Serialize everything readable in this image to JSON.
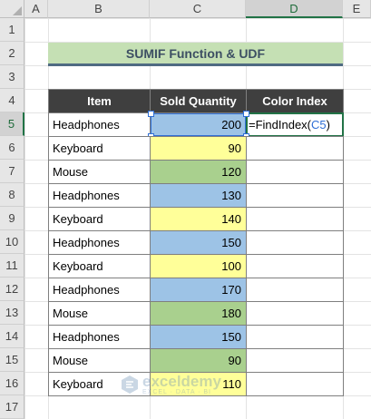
{
  "columns": [
    "A",
    "B",
    "C",
    "D",
    "E"
  ],
  "selected_column": "D",
  "rows": [
    "1",
    "2",
    "3",
    "4",
    "5",
    "6",
    "7",
    "8",
    "9",
    "10",
    "11",
    "12",
    "13",
    "14",
    "15",
    "16",
    "17"
  ],
  "selected_row": "5",
  "title": "SUMIF Function & UDF",
  "headers": {
    "item": "Item",
    "qty": "Sold Quantity",
    "color_index": "Color Index"
  },
  "table": [
    {
      "item": "Headphones",
      "qty": "200",
      "color": "blue"
    },
    {
      "item": "Keyboard",
      "qty": "90",
      "color": "yellow"
    },
    {
      "item": "Mouse",
      "qty": "120",
      "color": "green"
    },
    {
      "item": "Headphones",
      "qty": "130",
      "color": "blue"
    },
    {
      "item": "Keyboard",
      "qty": "140",
      "color": "yellow"
    },
    {
      "item": "Headphones",
      "qty": "150",
      "color": "blue"
    },
    {
      "item": "Keyboard",
      "qty": "100",
      "color": "yellow"
    },
    {
      "item": "Headphones",
      "qty": "170",
      "color": "blue"
    },
    {
      "item": "Mouse",
      "qty": "180",
      "color": "green"
    },
    {
      "item": "Headphones",
      "qty": "150",
      "color": "blue"
    },
    {
      "item": "Mouse",
      "qty": "90",
      "color": "green"
    },
    {
      "item": "Keyboard",
      "qty": "110",
      "color": "yellow"
    }
  ],
  "formula": {
    "prefix": "=FindIndex(",
    "ref": "C5",
    "suffix": ")"
  },
  "fill_colors": {
    "blue": "#9dc3e6",
    "yellow": "#ffff99",
    "green": "#a9d08e",
    "header": "#3f3f3f",
    "title": "#c5e0b4"
  },
  "watermark": {
    "name": "exceldemy",
    "tagline": "EXCEL · DATA · BI"
  }
}
